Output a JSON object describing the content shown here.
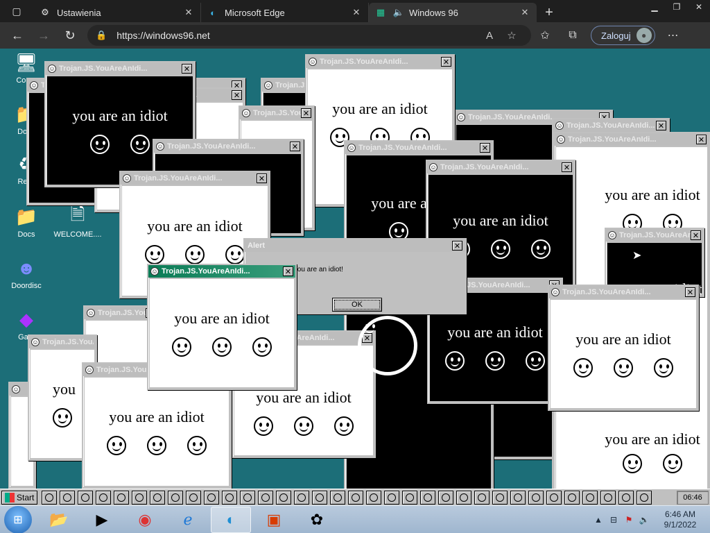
{
  "browser": {
    "tabs": [
      {
        "label": "Ustawienia",
        "icon": "gear-icon"
      },
      {
        "label": "Microsoft Edge",
        "icon": "edge-icon"
      },
      {
        "label": "Windows 96",
        "icon": "windows96-icon"
      }
    ],
    "url": "https://windows96.net",
    "signin_label": "Zaloguj"
  },
  "desktop": {
    "icons": [
      {
        "label": "Comp"
      },
      {
        "label": "Docu"
      },
      {
        "label": "Recy"
      },
      {
        "label": "Docs"
      },
      {
        "label": "WELCOME...."
      },
      {
        "label": "Doordisc"
      },
      {
        "label": "Gam"
      }
    ]
  },
  "virus": {
    "window_title": "Trojan.JS.YouAreAnIdi...",
    "message": "you are an idiot"
  },
  "alert": {
    "title": "Alert",
    "message": "You are an idiot!",
    "ok_label": "OK"
  },
  "w96_taskbar": {
    "start_label": "Start",
    "clock": "06:46"
  },
  "win7_taskbar": {
    "time": "6:46 AM",
    "date": "9/1/2022"
  },
  "colors": {
    "desktop": "#1c6e78",
    "focus_title": "#0a7b55"
  }
}
